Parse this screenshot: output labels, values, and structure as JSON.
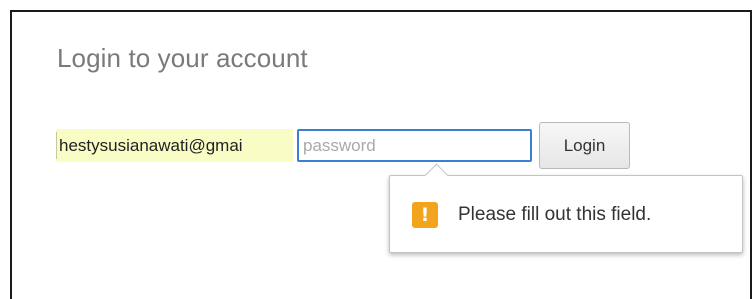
{
  "login": {
    "title": "Login to your account",
    "email_value": "hestysusianawati@gmai",
    "password_placeholder": "password",
    "login_label": "Login"
  },
  "validation": {
    "icon": "warning-icon",
    "icon_glyph": "!",
    "message": "Please fill out this field.",
    "icon_color": "#f2a41c"
  },
  "colors": {
    "autofill_background": "#fafcc6",
    "focus_border": "#3b7fd4"
  }
}
